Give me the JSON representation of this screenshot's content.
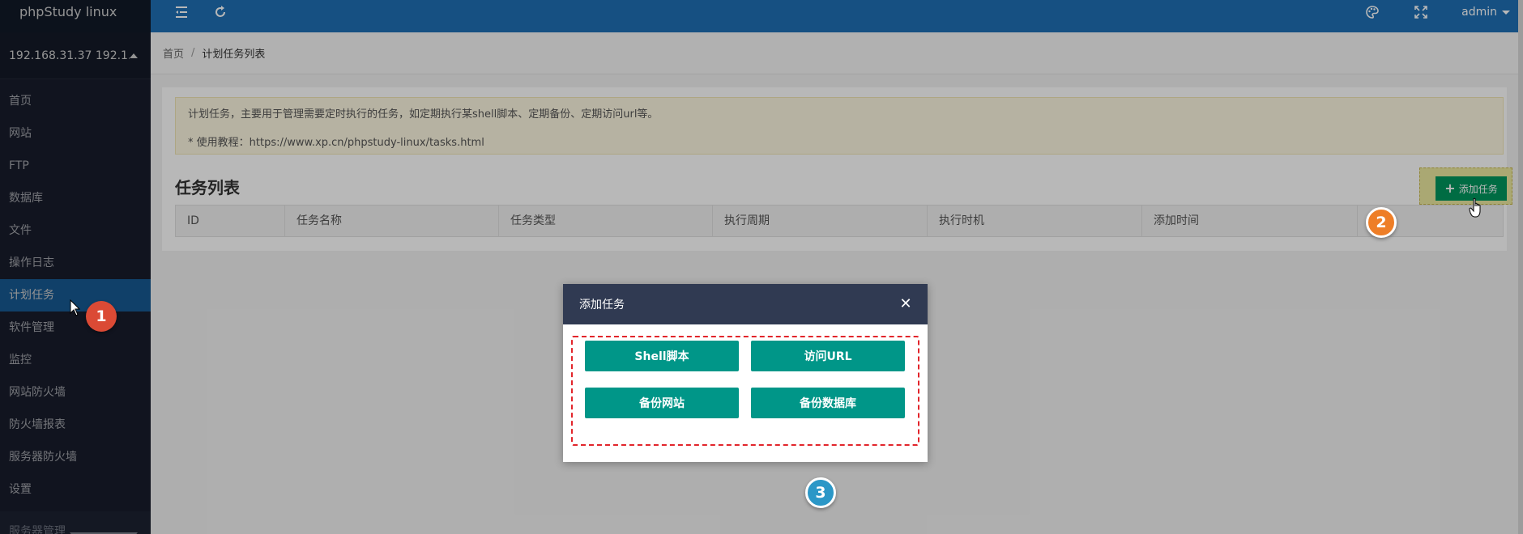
{
  "brand": "phpStudy linux",
  "server": {
    "ip": "192.168.31.37 192.1..."
  },
  "sidebar": {
    "items": [
      {
        "label": "首页"
      },
      {
        "label": "网站"
      },
      {
        "label": "FTP"
      },
      {
        "label": "数据库"
      },
      {
        "label": "文件"
      },
      {
        "label": "操作日志"
      },
      {
        "label": "计划任务",
        "active": true
      },
      {
        "label": "软件管理"
      },
      {
        "label": "监控"
      },
      {
        "label": "网站防火墙"
      },
      {
        "label": "防火墙报表"
      },
      {
        "label": "服务器防火墙"
      },
      {
        "label": "设置"
      }
    ],
    "footer": "服务器管理"
  },
  "topbar": {
    "icons": [
      "menu-collapse-icon",
      "refresh-icon",
      "palette-icon",
      "fullscreen-icon"
    ],
    "user": "admin"
  },
  "breadcrumb": {
    "home": "首页",
    "separator": "/",
    "current": "计划任务列表"
  },
  "notice": {
    "line1": "计划任务，主要用于管理需要定时执行的任务，如定期执行某shell脚本、定期备份、定期访问url等。",
    "line2": "* 使用教程：https://www.xp.cn/phpstudy-linux/tasks.html"
  },
  "task_list": {
    "title": "任务列表",
    "add_button": "添加任务",
    "columns": [
      "ID",
      "任务名称",
      "任务类型",
      "执行周期",
      "执行时机",
      "添加时间",
      ""
    ]
  },
  "modal": {
    "title": "添加任务",
    "buttons": {
      "shell": "Shell脚本",
      "url": "访问URL",
      "backup_site": "备份网站",
      "backup_db": "备份数据库"
    }
  },
  "markers": [
    "1",
    "2",
    "3"
  ],
  "colors": {
    "sidebar_bg": "#1f2536",
    "topbar_bg": "#1f6fb5",
    "active_item": "#1e6fb8",
    "primary_button": "#009688",
    "modal_header": "#303a52",
    "dashed_outline": "#e2252b",
    "marker1": "#db4a35",
    "marker2": "#ee7e27",
    "marker3": "#2b97c7"
  }
}
